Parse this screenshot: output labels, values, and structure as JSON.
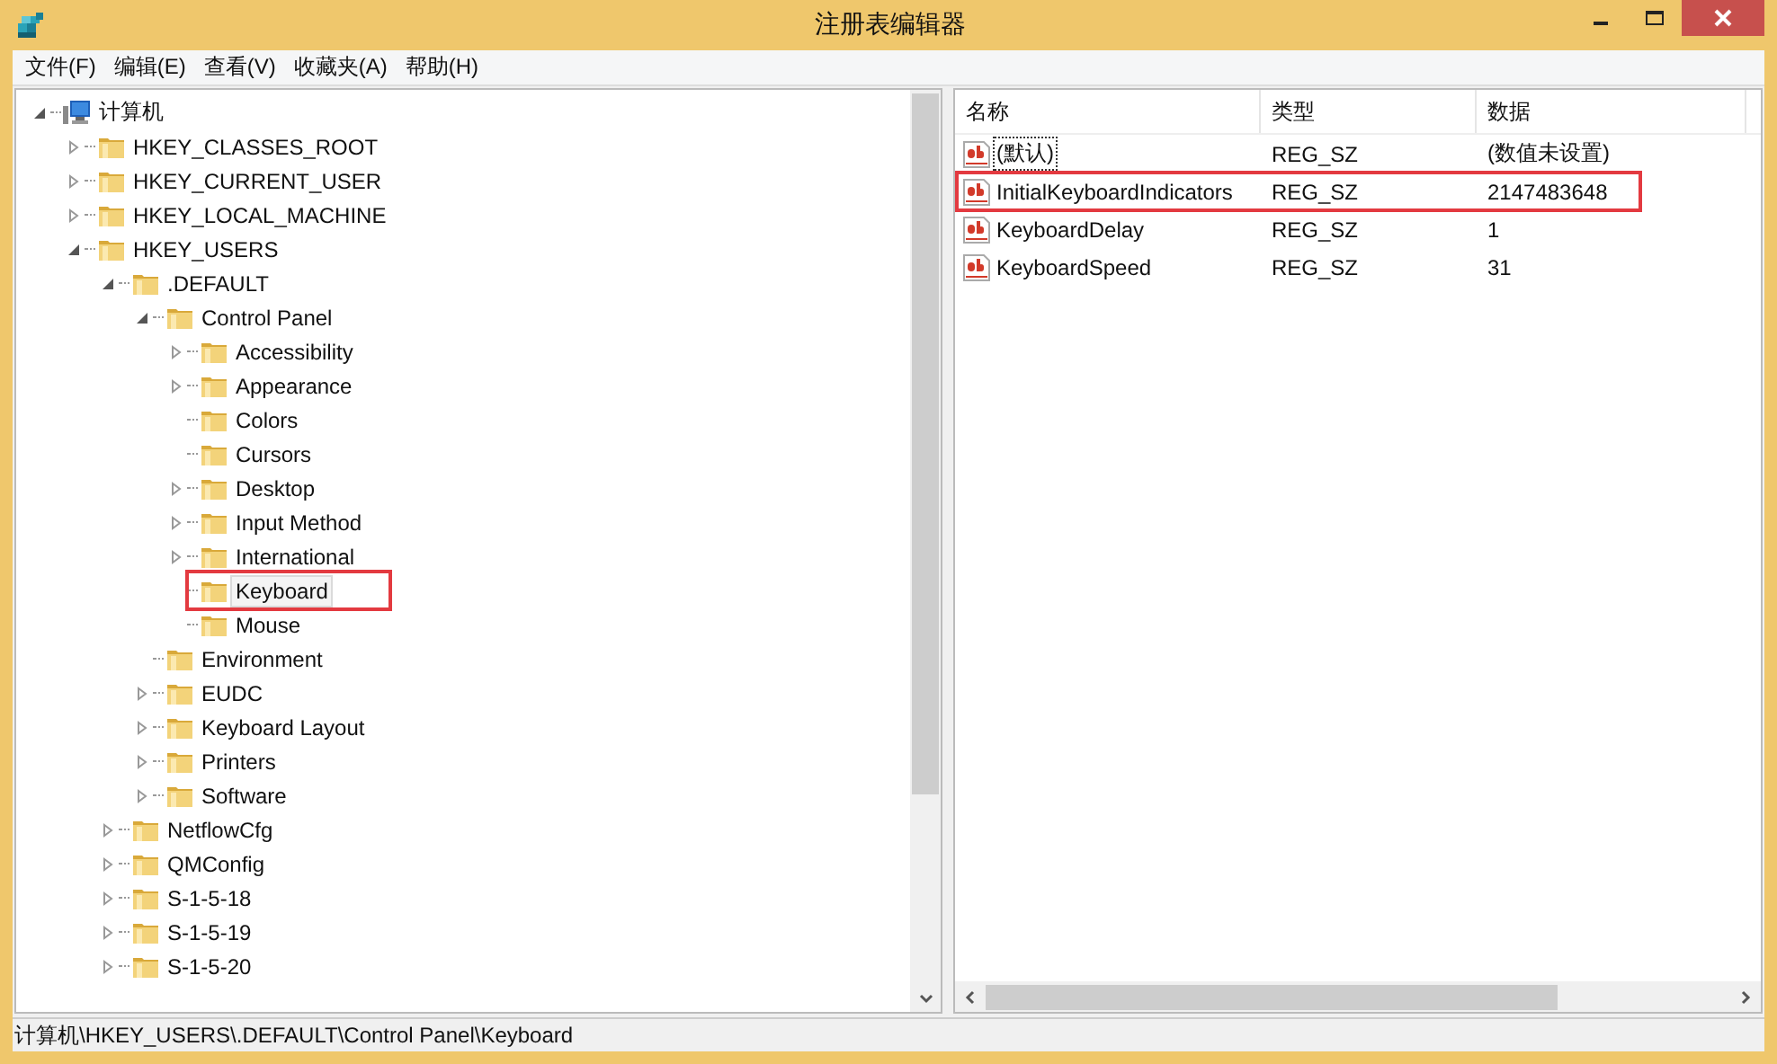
{
  "window": {
    "title": "注册表编辑器"
  },
  "menu": [
    "文件(F)",
    "编辑(E)",
    "查看(V)",
    "收藏夹(A)",
    "帮助(H)"
  ],
  "tree": [
    {
      "label": "计算机",
      "kind": "computer",
      "expanded": true,
      "selected": false,
      "highlighted": false,
      "children": [
        {
          "label": "HKEY_CLASSES_ROOT",
          "kind": "folder",
          "expanded": false,
          "selected": false,
          "highlighted": false
        },
        {
          "label": "HKEY_CURRENT_USER",
          "kind": "folder",
          "expanded": false,
          "selected": false,
          "highlighted": false
        },
        {
          "label": "HKEY_LOCAL_MACHINE",
          "kind": "folder",
          "expanded": false,
          "selected": false,
          "highlighted": false
        },
        {
          "label": "HKEY_USERS",
          "kind": "folder",
          "expanded": true,
          "selected": false,
          "highlighted": false,
          "children": [
            {
              "label": ".DEFAULT",
              "kind": "folder",
              "expanded": true,
              "selected": false,
              "highlighted": false,
              "children": [
                {
                  "label": "Control Panel",
                  "kind": "folder",
                  "expanded": true,
                  "selected": false,
                  "highlighted": false,
                  "children": [
                    {
                      "label": "Accessibility",
                      "kind": "folder",
                      "expanded": false,
                      "selected": false,
                      "highlighted": false
                    },
                    {
                      "label": "Appearance",
                      "kind": "folder",
                      "expanded": false,
                      "selected": false,
                      "highlighted": false
                    },
                    {
                      "label": "Colors",
                      "kind": "folder",
                      "selected": false,
                      "highlighted": false
                    },
                    {
                      "label": "Cursors",
                      "kind": "folder",
                      "selected": false,
                      "highlighted": false
                    },
                    {
                      "label": "Desktop",
                      "kind": "folder",
                      "expanded": false,
                      "selected": false,
                      "highlighted": false
                    },
                    {
                      "label": "Input Method",
                      "kind": "folder",
                      "expanded": false,
                      "selected": false,
                      "highlighted": false
                    },
                    {
                      "label": "International",
                      "kind": "folder",
                      "expanded": false,
                      "selected": false,
                      "highlighted": false
                    },
                    {
                      "label": "Keyboard",
                      "kind": "folder",
                      "selected": true,
                      "highlighted": true
                    },
                    {
                      "label": "Mouse",
                      "kind": "folder",
                      "selected": false,
                      "highlighted": false
                    }
                  ]
                },
                {
                  "label": "Environment",
                  "kind": "folder",
                  "selected": false,
                  "highlighted": false
                },
                {
                  "label": "EUDC",
                  "kind": "folder",
                  "expanded": false,
                  "selected": false,
                  "highlighted": false
                },
                {
                  "label": "Keyboard Layout",
                  "kind": "folder",
                  "expanded": false,
                  "selected": false,
                  "highlighted": false
                },
                {
                  "label": "Printers",
                  "kind": "folder",
                  "expanded": false,
                  "selected": false,
                  "highlighted": false
                },
                {
                  "label": "Software",
                  "kind": "folder",
                  "expanded": false,
                  "selected": false,
                  "highlighted": false
                }
              ]
            },
            {
              "label": "NetflowCfg",
              "kind": "folder",
              "expanded": false,
              "selected": false,
              "highlighted": false
            },
            {
              "label": "QMConfig",
              "kind": "folder",
              "expanded": false,
              "selected": false,
              "highlighted": false
            },
            {
              "label": "S-1-5-18",
              "kind": "folder",
              "expanded": false,
              "selected": false,
              "highlighted": false
            },
            {
              "label": "S-1-5-19",
              "kind": "folder",
              "expanded": false,
              "selected": false,
              "highlighted": false
            },
            {
              "label": "S-1-5-20",
              "kind": "folder",
              "expanded": false,
              "selected": false,
              "highlighted": false
            }
          ]
        }
      ]
    }
  ],
  "values": {
    "columns": [
      "名称",
      "类型",
      "数据"
    ],
    "rows": [
      {
        "name": "(默认)",
        "type": "REG_SZ",
        "data": "(数值未设置)",
        "focused": true,
        "highlighted": false
      },
      {
        "name": "InitialKeyboardIndicators",
        "type": "REG_SZ",
        "data": "2147483648",
        "focused": false,
        "highlighted": true
      },
      {
        "name": "KeyboardDelay",
        "type": "REG_SZ",
        "data": "1",
        "focused": false,
        "highlighted": false
      },
      {
        "name": "KeyboardSpeed",
        "type": "REG_SZ",
        "data": "31",
        "focused": false,
        "highlighted": false
      }
    ]
  },
  "status_bar": "计算机\\HKEY_USERS\\.DEFAULT\\Control Panel\\Keyboard"
}
